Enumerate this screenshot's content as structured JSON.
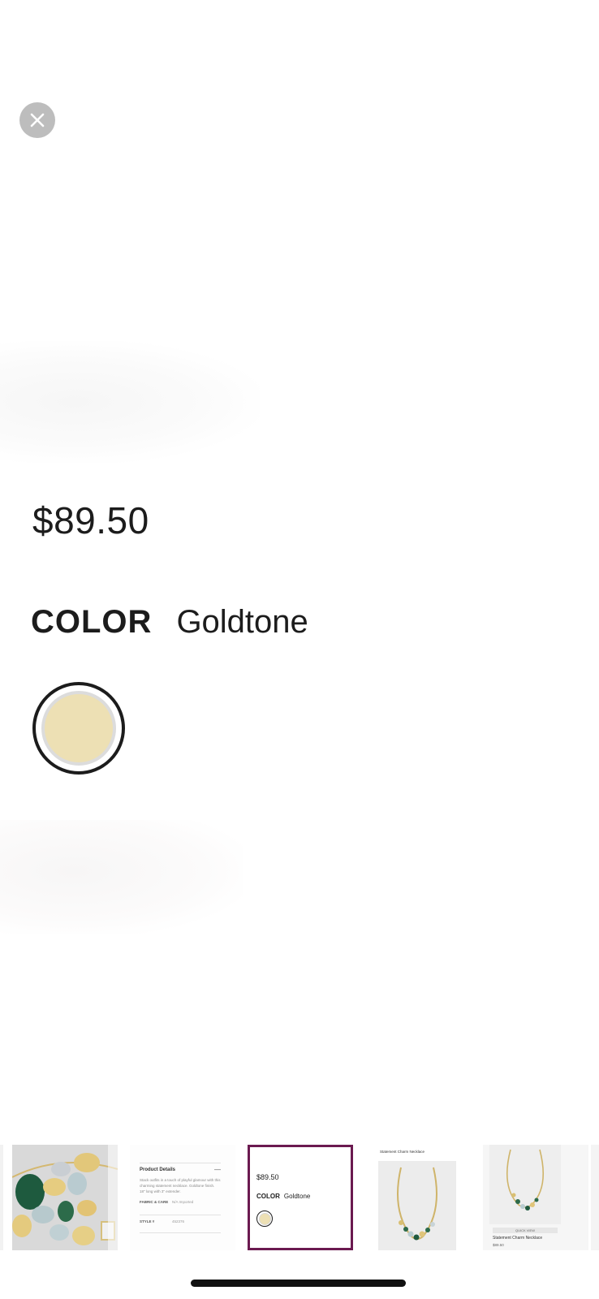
{
  "product": {
    "price": "$89.50",
    "color_label": "COLOR",
    "color_value": "Goldtone",
    "swatch_color": "#ede0b4"
  },
  "close_button": {
    "icon": "close-icon"
  },
  "thumbnails": {
    "details": {
      "title": "Product Details",
      "toggle": "—",
      "description": "Stack outfits in a touch of playful glamour with this charming statement necklace. Goldtone finish. 18\" long with 3\" extender.",
      "fabric_label": "FABRIC & CARE",
      "fabric_value": "N/A Imported",
      "style_label": "STYLE #",
      "style_value": "452376"
    },
    "price_color": {
      "price": "$89.50",
      "color_label": "COLOR",
      "color_value": "Goldtone"
    },
    "necklace_full": {
      "header": "Statement Charm Necklace"
    },
    "product_card": {
      "quick_view": "QUICK VIEW",
      "name": "Statement Charm Necklace",
      "price": "$89.50"
    },
    "selected_border_color": "#6b1a50"
  }
}
